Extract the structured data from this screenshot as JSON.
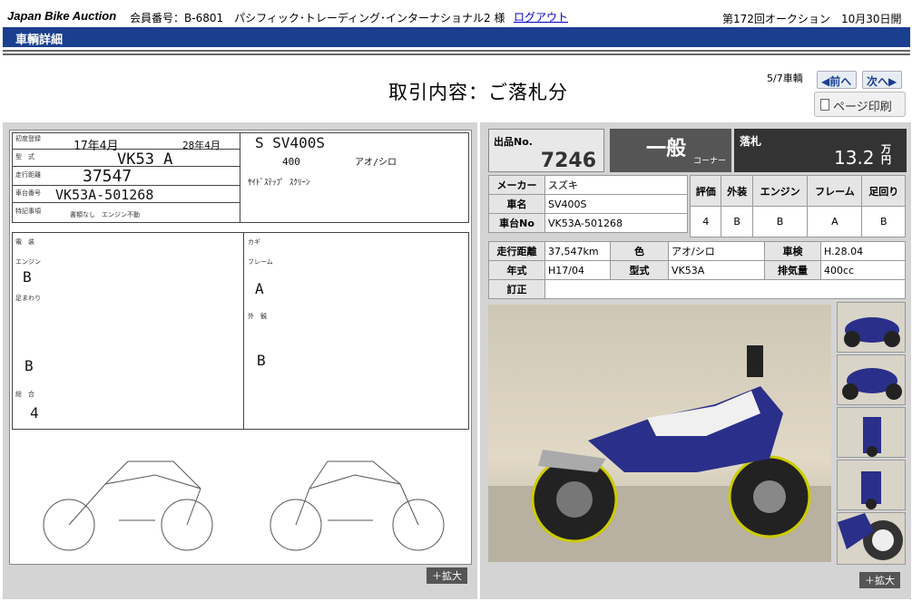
{
  "header": {
    "logo": "Japan Bike Auction",
    "member_info": "会員番号：B-6801　パシフィック･トレーディング･インターナショナル2 様",
    "logout": "ログアウト",
    "auction_no": "第172回オークション",
    "auction_date": "10月30日開催"
  },
  "nav": {
    "title": "車輌詳細"
  },
  "page": {
    "title": "取引内容：ご落札分"
  },
  "pager": {
    "position": "5/7車輌",
    "prev": "◀前へ",
    "next": "次へ▶",
    "print": "ページ印刷"
  },
  "sheet": {
    "reg_date": "17年4月",
    "inspection": "28年4月",
    "model_name": "S SV400S",
    "model_code": "VK53 A",
    "mileage": "37547",
    "displacement": "400",
    "color": "アオ/シロ",
    "frame_no": "VK53A-501268",
    "notes": "ｻｲﾄﾞｽﾃｯﾌﾟ  ｽｸﾘｰﾝ",
    "docs": "書類なし　エンジン不動",
    "engine_grade": "B",
    "front_grade": "B",
    "total": "4",
    "frame_grade": "A",
    "exterior_grade": "B",
    "enlarge": "＋拡大"
  },
  "lot": {
    "label": "出品No.",
    "number": "7246",
    "corner": "一般",
    "corner_sub": "コーナー",
    "sold_label": "落札",
    "price": "13.2",
    "unit": "万円"
  },
  "specs": {
    "maker_label": "メーカー",
    "maker": "スズキ",
    "name_label": "車名",
    "name": "SV400S",
    "frame_label": "車台No",
    "frame": "VK53A-501268"
  },
  "grades": {
    "headers": [
      "評価",
      "外装",
      "エンジン",
      "フレーム",
      "足回り"
    ],
    "values": [
      "4",
      "B",
      "B",
      "A",
      "B"
    ]
  },
  "details": {
    "mileage_label": "走行距離",
    "mileage": "37,547km",
    "color_label": "色",
    "color": "アオ/シロ",
    "inspection_label": "車検",
    "inspection": "H.28.04",
    "year_label": "年式",
    "year": "H17/04",
    "model_label": "型式",
    "model": "VK53A",
    "cc_label": "排気量",
    "cc": "400cc",
    "correction_label": "訂正",
    "correction": ""
  },
  "photos": {
    "enlarge": "＋拡大"
  }
}
